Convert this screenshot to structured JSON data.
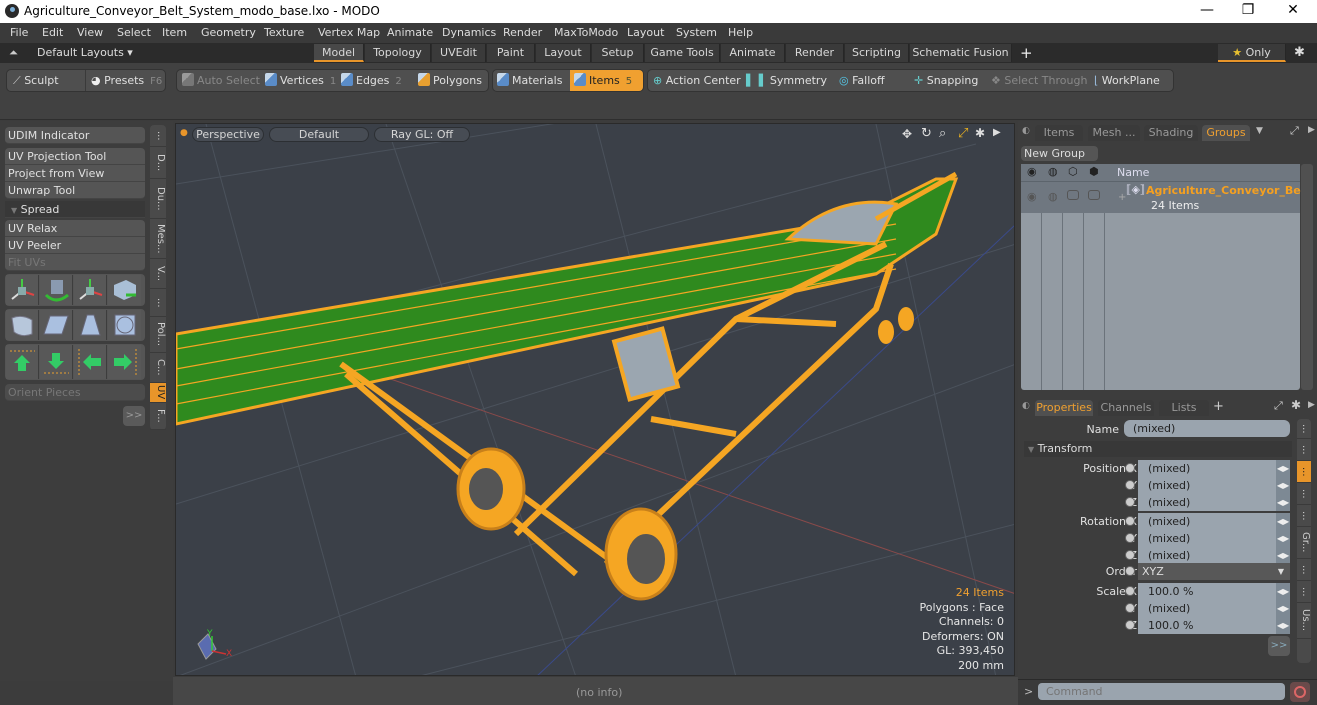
{
  "window": {
    "title": "Agriculture_Conveyor_Belt_System_modo_base.lxo - MODO",
    "controls": {
      "minimize": "—",
      "restore": "❐",
      "close": "✕"
    }
  },
  "menu": [
    "File",
    "Edit",
    "View",
    "Select",
    "Item",
    "Geometry",
    "Texture",
    "Vertex Map",
    "Animate",
    "Dynamics",
    "Render",
    "MaxToModo",
    "Layout",
    "System",
    "Help"
  ],
  "layouts": {
    "selector_label": "Default Layouts ▾",
    "tabs": [
      "Model",
      "Topology",
      "UVEdit",
      "Paint",
      "Layout",
      "Setup",
      "Game Tools",
      "Animate",
      "Render",
      "Scripting",
      "Schematic Fusion"
    ],
    "active_tab": "Model",
    "add_label": "+",
    "only_label": "Only",
    "star": "★"
  },
  "toolbar": {
    "sculpt": "Sculpt",
    "presets": "Presets",
    "presets_key": "F6",
    "auto_select": "Auto Select",
    "vertices": "Vertices",
    "vertices_key": "1",
    "edges": "Edges",
    "edges_key": "2",
    "polygons": "Polygons",
    "materials": "Materials",
    "items": "Items",
    "items_key": "5",
    "action_center": "Action Center",
    "symmetry": "Symmetry",
    "falloff": "Falloff",
    "snapping": "Snapping",
    "select_through": "Select Through",
    "workplane": "WorkPlane"
  },
  "left_panel": {
    "udim": "UDIM Indicator",
    "tools": [
      "UV Projection Tool",
      "Project from View",
      "Unwrap Tool"
    ],
    "spread": "Spread",
    "tools2": [
      "UV Relax",
      "UV Peeler",
      "Fit UVs"
    ],
    "orient": "Orient Pieces",
    "more": ">>",
    "vtabs": [
      "...",
      "D...",
      "Du...",
      "Mes...",
      "V...",
      "...",
      "Pol...",
      "C...",
      "UV",
      "F..."
    ],
    "active_vtab": "UV"
  },
  "viewport": {
    "view": "Perspective",
    "shading": "Default",
    "raygl": "Ray GL: Off",
    "stats": {
      "items": "24 Items",
      "polygons": "Polygons : Face",
      "channels": "Channels: 0",
      "deformers": "Deformers: ON",
      "gl": "GL: 393,450",
      "unit": "200 mm"
    },
    "axis": {
      "x": "X",
      "y": "Y"
    }
  },
  "status": {
    "info": "(no info)"
  },
  "items_panel": {
    "tabs": [
      "Items",
      "Mesh ...",
      "Shading",
      "Groups"
    ],
    "active_tab": "Groups",
    "new_group": "New Group",
    "col_name": "Name",
    "group_name": "Agriculture_Conveyor_Be...",
    "group_count": "24 Items"
  },
  "properties": {
    "tabs": [
      "Properties",
      "Channels",
      "Lists"
    ],
    "active_tab": "Properties",
    "add": "+",
    "name_label": "Name",
    "name_value": "(mixed)",
    "section": "Transform",
    "rows": [
      {
        "label": "Position X",
        "value": "(mixed)"
      },
      {
        "label": "Y",
        "value": "(mixed)"
      },
      {
        "label": "Z",
        "value": "(mixed)"
      },
      {
        "label": "Rotation X",
        "value": "(mixed)"
      },
      {
        "label": "Y",
        "value": "(mixed)"
      },
      {
        "label": "Z",
        "value": "(mixed)"
      },
      {
        "label": "Order",
        "value": "XYZ"
      },
      {
        "label": "Scale X",
        "value": "100.0 %"
      },
      {
        "label": "Y",
        "value": "(mixed)"
      },
      {
        "label": "Z",
        "value": "100.0 %"
      }
    ],
    "more": ">>",
    "side_tabs": [
      "...",
      "...",
      "...",
      "...",
      "...",
      "Gr...",
      "...",
      "...",
      "Us..."
    ]
  },
  "command": {
    "placeholder": "Command",
    "prompt": ">"
  },
  "colors": {
    "accent": "#e8952a",
    "selection": "#f5a623",
    "belt_green": "#2f8a1e"
  }
}
